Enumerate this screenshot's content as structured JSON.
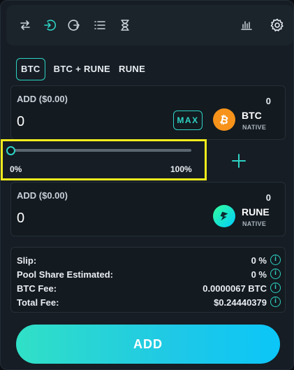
{
  "topbar": {
    "icons": [
      "swap-icon",
      "add-liquidity-icon",
      "withdraw-icon",
      "list-icon",
      "hourglass-icon",
      "chart-icon",
      "gear-icon"
    ]
  },
  "tabs": [
    {
      "label": "BTC",
      "active": true
    },
    {
      "label": "BTC + RUNE",
      "active": false
    },
    {
      "label": "RUNE",
      "active": false
    }
  ],
  "input_asset": {
    "label": "ADD ($0.00)",
    "amount": "0",
    "balance": "0",
    "max_label": "MAX",
    "asset": "BTC",
    "chain": "NATIVE",
    "color": "#f7931a"
  },
  "slider": {
    "min_label": "0%",
    "max_label": "100%",
    "value_percent": 0
  },
  "output_asset": {
    "label": "ADD ($0.00)",
    "amount": "0",
    "balance": "0",
    "asset": "RUNE",
    "chain": "NATIVE",
    "color": "#21c3b2"
  },
  "fees": [
    {
      "label": "Slip:",
      "value": "0 %"
    },
    {
      "label": "Pool Share Estimated:",
      "value": "0 %"
    },
    {
      "label": "BTC Fee:",
      "value": "0.0000067 BTC"
    },
    {
      "label": "Total Fee:",
      "value": "$0.24440379"
    }
  ],
  "info_glyph": "i",
  "action": {
    "label": "ADD"
  },
  "colors": {
    "accent": "#2ed3c4",
    "highlight": "#f3ec1c"
  }
}
